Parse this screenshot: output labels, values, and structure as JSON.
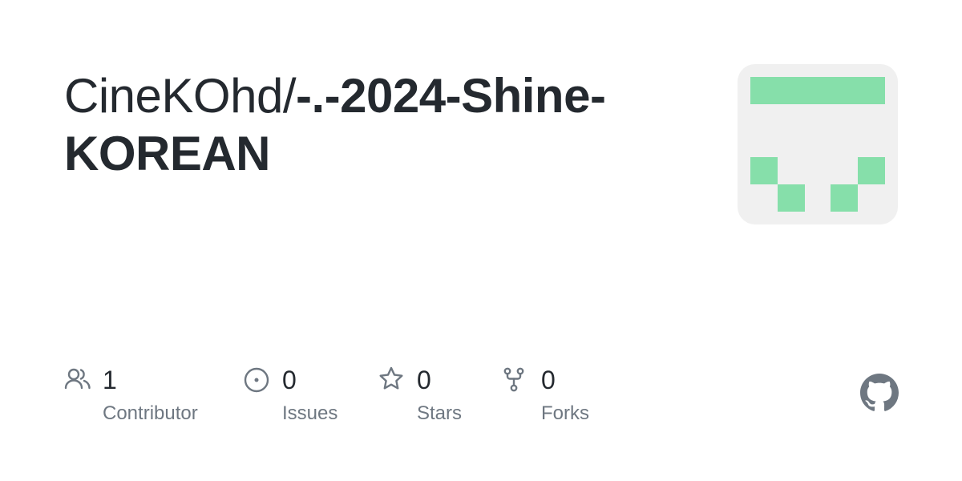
{
  "repo": {
    "owner": "CineKOhd/",
    "name": "-.-2024-Shine-KOREAN"
  },
  "stats": [
    {
      "icon": "contributors-icon",
      "count": "1",
      "label": "Contributor"
    },
    {
      "icon": "issues-icon",
      "count": "0",
      "label": "Issues"
    },
    {
      "icon": "star-icon",
      "count": "0",
      "label": "Stars"
    },
    {
      "icon": "fork-icon",
      "count": "0",
      "label": "Forks"
    }
  ],
  "colors": {
    "identicon": "#86dfaa",
    "identicon_bg": "#f0f0f0",
    "icon": "#6e7781",
    "text": "#24292f"
  }
}
